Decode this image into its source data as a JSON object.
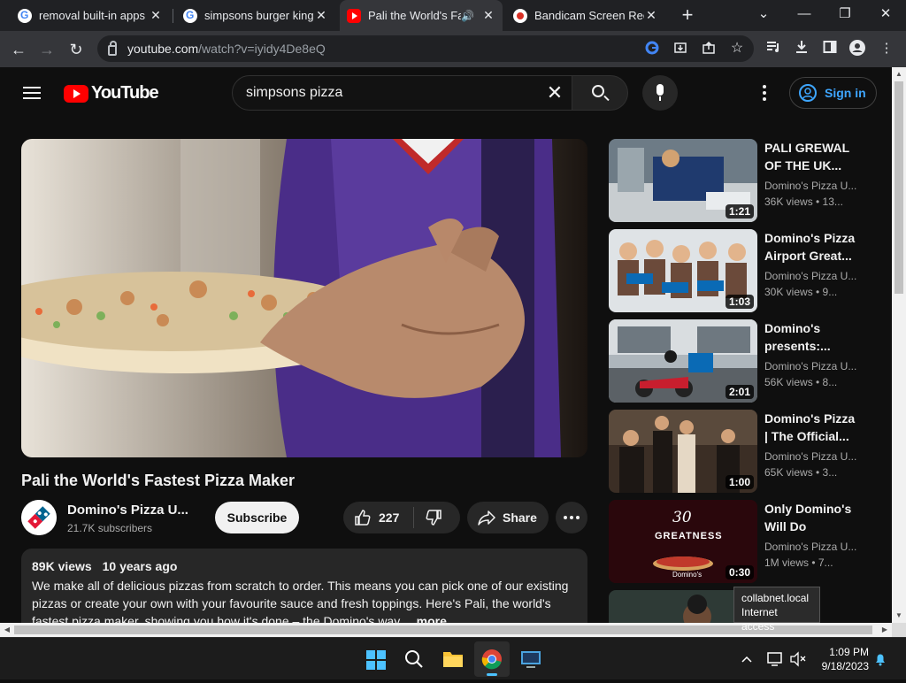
{
  "browser": {
    "tabs": [
      {
        "title": "removal built-in apps",
        "favicon": "google-icon"
      },
      {
        "title": "simpsons burger king",
        "favicon": "google-icon"
      },
      {
        "title": "Pali the World's Fa",
        "favicon": "youtube-icon",
        "active": true,
        "audio": true
      },
      {
        "title": "Bandicam Screen Reco",
        "favicon": "bandicam-icon"
      }
    ],
    "url_host": "youtube.com",
    "url_path": "/watch?v=iyidy4De8eQ"
  },
  "youtube": {
    "logo_text": "YouTube",
    "search_query": "simpsons pizza",
    "sign_in": "Sign in",
    "video": {
      "title": "Pali the World's Fastest Pizza Maker",
      "channel": "Domino's Pizza U...",
      "subscribers": "21.7K subscribers",
      "subscribe_label": "Subscribe",
      "likes": "227",
      "share_label": "Share",
      "views": "89K views",
      "age": "10 years ago",
      "description": "We make all of delicious pizzas from scratch to order. This means you can pick one of our existing pizzas or create your own with your favourite sauce and fresh toppings. Here's Pali, the world's fastest pizza maker, showing you how it's done – the Domino's way.",
      "more_label": "...more"
    },
    "related": [
      {
        "title": "PALI GREWAL OF THE UK...",
        "channel": "Domino's Pizza U...",
        "meta": "36K views • 13...",
        "duration": "1:21"
      },
      {
        "title": "Domino's Pizza Airport Great...",
        "channel": "Domino's Pizza U...",
        "meta": "30K views • 9...",
        "duration": "1:03"
      },
      {
        "title": "Domino's presents:...",
        "channel": "Domino's Pizza U...",
        "meta": "56K views • 8...",
        "duration": "2:01"
      },
      {
        "title": "Domino's Pizza | The Official...",
        "channel": "Domino's Pizza U...",
        "meta": "65K views • 3...",
        "duration": "1:00"
      },
      {
        "title": "Only Domino's Will Do",
        "channel": "Domino's Pizza U...",
        "meta": "1M views • 7...",
        "duration": "0:30"
      }
    ],
    "thumb_text_30": "30",
    "thumb_text_greatness": "GREATNESS",
    "thumb_text_brand": "Domino's"
  },
  "tooltip": {
    "line1": "collabnet.local",
    "line2": "Internet access"
  },
  "taskbar": {
    "time": "1:09 PM",
    "date": "9/18/2023"
  },
  "colors": {
    "accent": "#3ea6ff",
    "brand_red": "#ff0000",
    "win_accent": "#4cc2ff"
  }
}
